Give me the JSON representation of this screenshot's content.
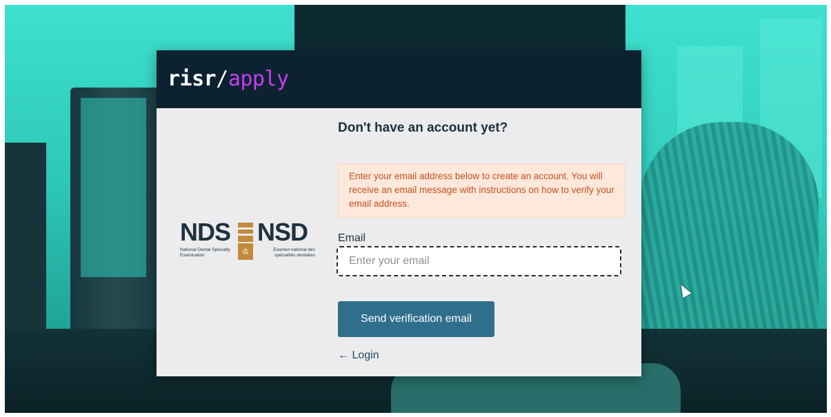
{
  "header": {
    "brand_risr": "risr",
    "brand_slash": "/",
    "brand_apply": "apply"
  },
  "logo": {
    "left_big": "NDS",
    "right_big": "NSD",
    "left_small": "National Dental Specialty Examination",
    "right_small": "Examen national des spécialités dentaires"
  },
  "form": {
    "heading": "Don't have an account yet?",
    "alert": "Enter your email address below to create an account. You will receive an email message with instructions on how to verify your email address.",
    "email_label": "Email",
    "email_placeholder": "Enter your email",
    "email_value": "",
    "send_button": "Send verification email",
    "login_link": "← Login"
  },
  "colors": {
    "header_bg": "#0d2230",
    "brand_accent": "#c83df2",
    "button_bg": "#2f6f8c",
    "alert_bg": "#fde8db",
    "alert_text": "#c5501c",
    "background_teal": "#3fe0cf"
  }
}
